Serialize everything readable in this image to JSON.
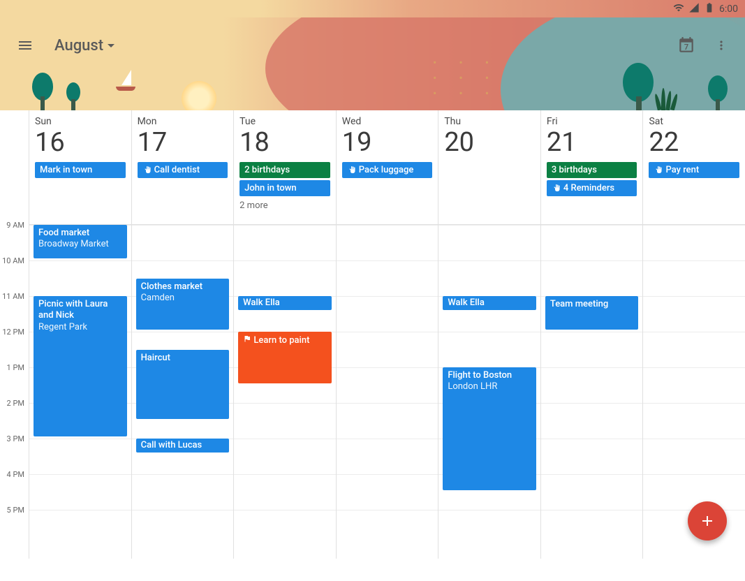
{
  "status_bar": {
    "time": "6:00"
  },
  "header": {
    "month_label": "August",
    "today_date": "7"
  },
  "time_labels": [
    "9 AM",
    "10 AM",
    "11 AM",
    "12 PM",
    "1 PM",
    "2 PM",
    "3 PM",
    "4 PM",
    "5 PM"
  ],
  "hour_height": 51,
  "days": [
    {
      "name": "Sun",
      "num": "16",
      "all_day": [
        {
          "type": "blue",
          "label": "Mark in town"
        }
      ],
      "events": [
        {
          "title": "Food market",
          "loc": "Broadway Market",
          "color": "blue",
          "start": 9,
          "end": 10
        },
        {
          "title": "Picnic with Laura and Nick",
          "loc": "Regent Park",
          "color": "blue",
          "start": 11,
          "end": 15
        }
      ]
    },
    {
      "name": "Mon",
      "num": "17",
      "all_day": [
        {
          "type": "blue",
          "icon": "hand",
          "label": "Call dentist"
        }
      ],
      "events": [
        {
          "title": "Clothes market",
          "loc": "Camden",
          "color": "blue",
          "start": 10.5,
          "end": 12
        },
        {
          "title": "Haircut",
          "color": "blue",
          "start": 12.5,
          "end": 14.5
        },
        {
          "title": "Call with Lucas",
          "color": "blue",
          "start": 15,
          "end": 15.45
        }
      ]
    },
    {
      "name": "Tue",
      "num": "18",
      "all_day": [
        {
          "type": "green",
          "label": "2 birthdays"
        },
        {
          "type": "blue",
          "label": "John in town"
        }
      ],
      "more": "2 more",
      "events": [
        {
          "title": "Walk Ella",
          "color": "blue",
          "start": 11,
          "end": 11.45
        },
        {
          "title": "Learn to paint",
          "icon": "flag",
          "color": "orange",
          "start": 12,
          "end": 13.5
        }
      ]
    },
    {
      "name": "Wed",
      "num": "19",
      "all_day": [
        {
          "type": "blue",
          "icon": "hand",
          "label": "Pack luggage"
        }
      ],
      "events": []
    },
    {
      "name": "Thu",
      "num": "20",
      "all_day": [],
      "events": [
        {
          "title": "Walk Ella",
          "color": "blue",
          "start": 11,
          "end": 11.45
        },
        {
          "title": "Flight to Boston",
          "loc": "London LHR",
          "color": "blue",
          "start": 13,
          "end": 16.5
        }
      ]
    },
    {
      "name": "Fri",
      "num": "21",
      "all_day": [
        {
          "type": "green",
          "label": "3 birthdays"
        },
        {
          "type": "blue",
          "icon": "hand",
          "label": "4 Reminders"
        }
      ],
      "events": [
        {
          "title": "Team meeting",
          "color": "blue",
          "start": 11,
          "end": 12
        }
      ]
    },
    {
      "name": "Sat",
      "num": "22",
      "all_day": [
        {
          "type": "blue",
          "icon": "hand",
          "label": "Pay rent"
        }
      ],
      "events": []
    }
  ]
}
